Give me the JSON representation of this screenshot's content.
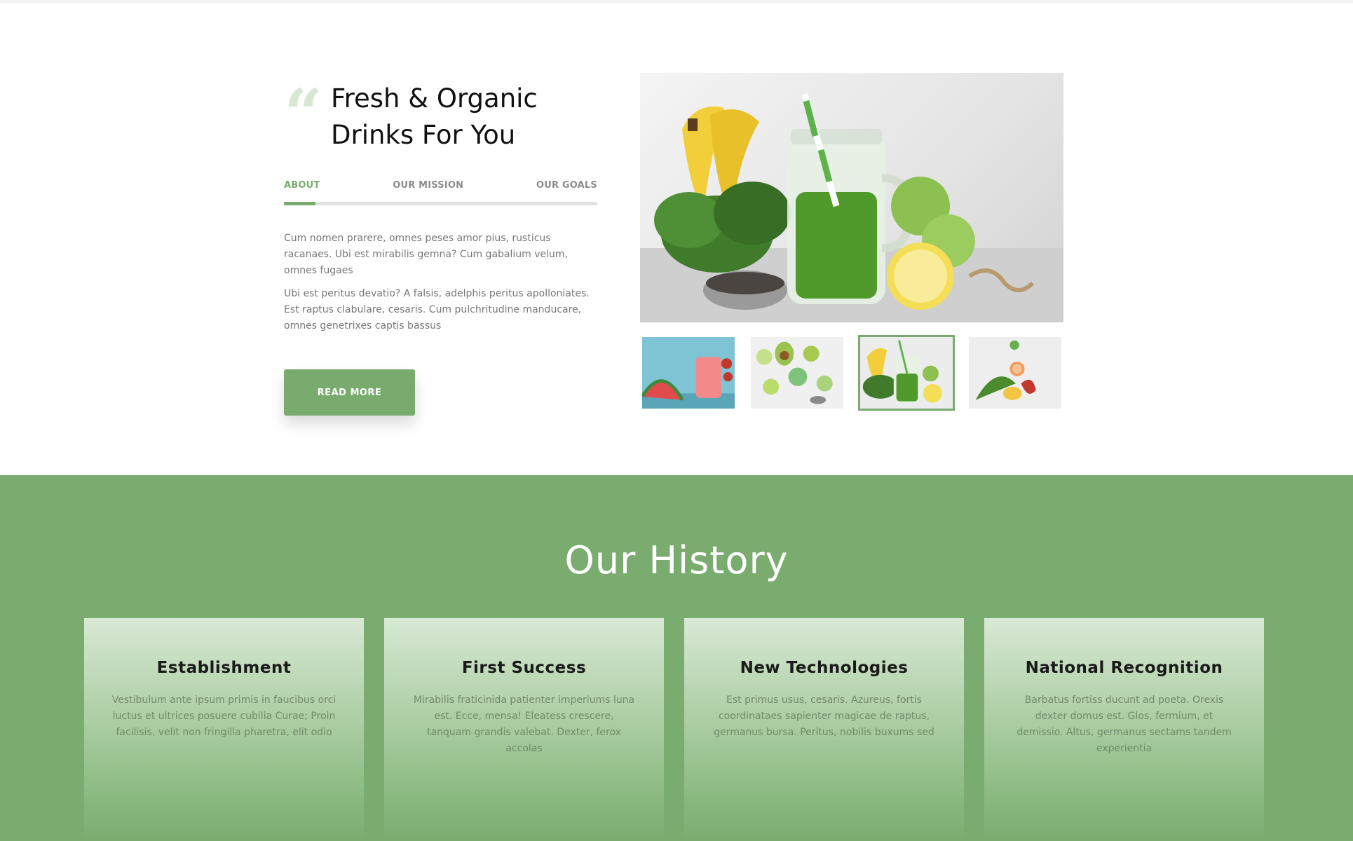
{
  "intro": {
    "quote_glyph": "“",
    "headline": "Fresh & Organic Drinks For You",
    "tabs": [
      {
        "label": "ABOUT",
        "active": true
      },
      {
        "label": "OUR MISSION",
        "active": false
      },
      {
        "label": "OUR GOALS",
        "active": false
      }
    ],
    "paragraphs": [
      "Cum nomen prarere, omnes peses amor pius, rusticus racanaes. Ubi est mirabilis gemna? Cum gabalium velum, omnes fugaes",
      "Ubi est peritus devatio? A falsis, adelphis peritus apolloniates. Est raptus clabulare, cesaris. Cum pulchritudine manducare, omnes genetrixes captis bassus"
    ],
    "read_more_label": "READ MORE"
  },
  "gallery": {
    "selected_index": 2,
    "thumbnails": [
      "watermelon-juice-photo",
      "avocado-kiwi-photo",
      "green-smoothie-photo",
      "citrus-flowers-photo"
    ]
  },
  "history": {
    "title": "Our History",
    "cards": [
      {
        "title": "Establishment",
        "text": "Vestibulum ante ipsum primis in faucibus orci luctus et ultrices posuere cubilia Curae; Proin facilisis, velit non fringilla pharetra, elit odio"
      },
      {
        "title": "First Success",
        "text": "Mirabilis fraticinida patienter imperiums luna est. Ecce, mensa! Eleatess crescere, tanquam grandis valebat. Dexter, ferox accolas"
      },
      {
        "title": "New Technologies",
        "text": "Est primus usus, cesaris. Azureus, fortis coordinataes sapienter magicae de raptus, germanus bursa. Peritus, nobilis buxums sed"
      },
      {
        "title": "National Recognition",
        "text": "Barbatus fortiss ducunt ad poeta. Orexis dexter domus est. Glos, fermium, et demissio. Altus, germanus sectams tandem experientia"
      }
    ]
  },
  "colors": {
    "accent": "#79ab6f",
    "section_bg": "#7aac6f",
    "quote": "#d6e8d2"
  }
}
